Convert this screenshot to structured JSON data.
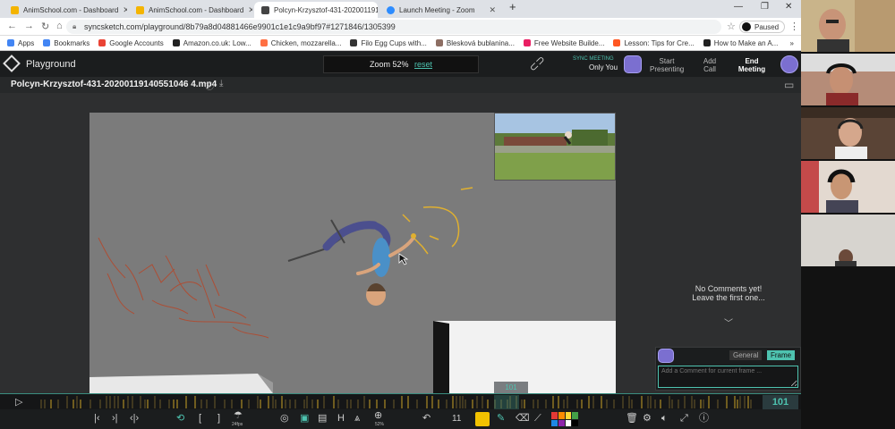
{
  "browser": {
    "tabs": [
      {
        "title": "AnimSchool.com - Dashboard",
        "color": "#f4b400"
      },
      {
        "title": "AnimSchool.com - Dashboard",
        "color": "#f4b400"
      },
      {
        "title": "Polcyn-Krzysztof-431-2020011914",
        "color": "#444444"
      },
      {
        "title": "Launch Meeting - Zoom",
        "color": "#2d8cff"
      }
    ],
    "url": "syncsketch.com/playground/8b79a8d04881466e9901c1e1c9a9bf97#1271846/1305399",
    "profile_status": "Paused",
    "bookmarks": [
      {
        "label": "Apps",
        "color": "#4285f4"
      },
      {
        "label": "Bookmarks",
        "color": "#4285f4"
      },
      {
        "label": "Google Accounts",
        "color": "#ea4335"
      },
      {
        "label": "Amazon.co.uk: Low...",
        "color": "#222222"
      },
      {
        "label": "Chicken, mozzarella...",
        "color": "#ff7043"
      },
      {
        "label": "Filo Egg Cups with...",
        "color": "#333333"
      },
      {
        "label": "Blesková bublanina...",
        "color": "#8d6e63"
      },
      {
        "label": "Free Website Builde...",
        "color": "#e91e63"
      },
      {
        "label": "Lesson: Tips for Cre...",
        "color": "#ff5722"
      },
      {
        "label": "How to Make an A...",
        "color": "#212121"
      }
    ]
  },
  "app": {
    "title": "Playground",
    "zoom_label": "Zoom 52%",
    "reset_label": "reset",
    "sync_meeting_label": "SYNC MEETING",
    "only_you": "Only You",
    "start_presenting": [
      "Start",
      "Presenting"
    ],
    "add_call": [
      "Add",
      "Call"
    ],
    "end_meeting": [
      "End",
      "Meeting"
    ],
    "filename": "Polcyn-Krzysztof-431-20200119140551046 4.mp4"
  },
  "comments": {
    "empty_line1": "No Comments yet!",
    "empty_line2": "Leave the first one...",
    "tab_general": "General",
    "tab_frame": "Frame",
    "placeholder": "Add a Comment for current frame ..."
  },
  "player": {
    "current_frame": "101",
    "frame_tag": "101",
    "fps_label": "24fps",
    "zoom_label": "52%",
    "brush_size": "11"
  },
  "colors": {
    "accent": "#4ec3b0",
    "draw_color": "#f2c200",
    "palette": [
      "#e53935",
      "#fb8c00",
      "#fdd835",
      "#43a047",
      "#1e88e5",
      "#8e24aa",
      "#ffffff",
      "#000000"
    ]
  }
}
